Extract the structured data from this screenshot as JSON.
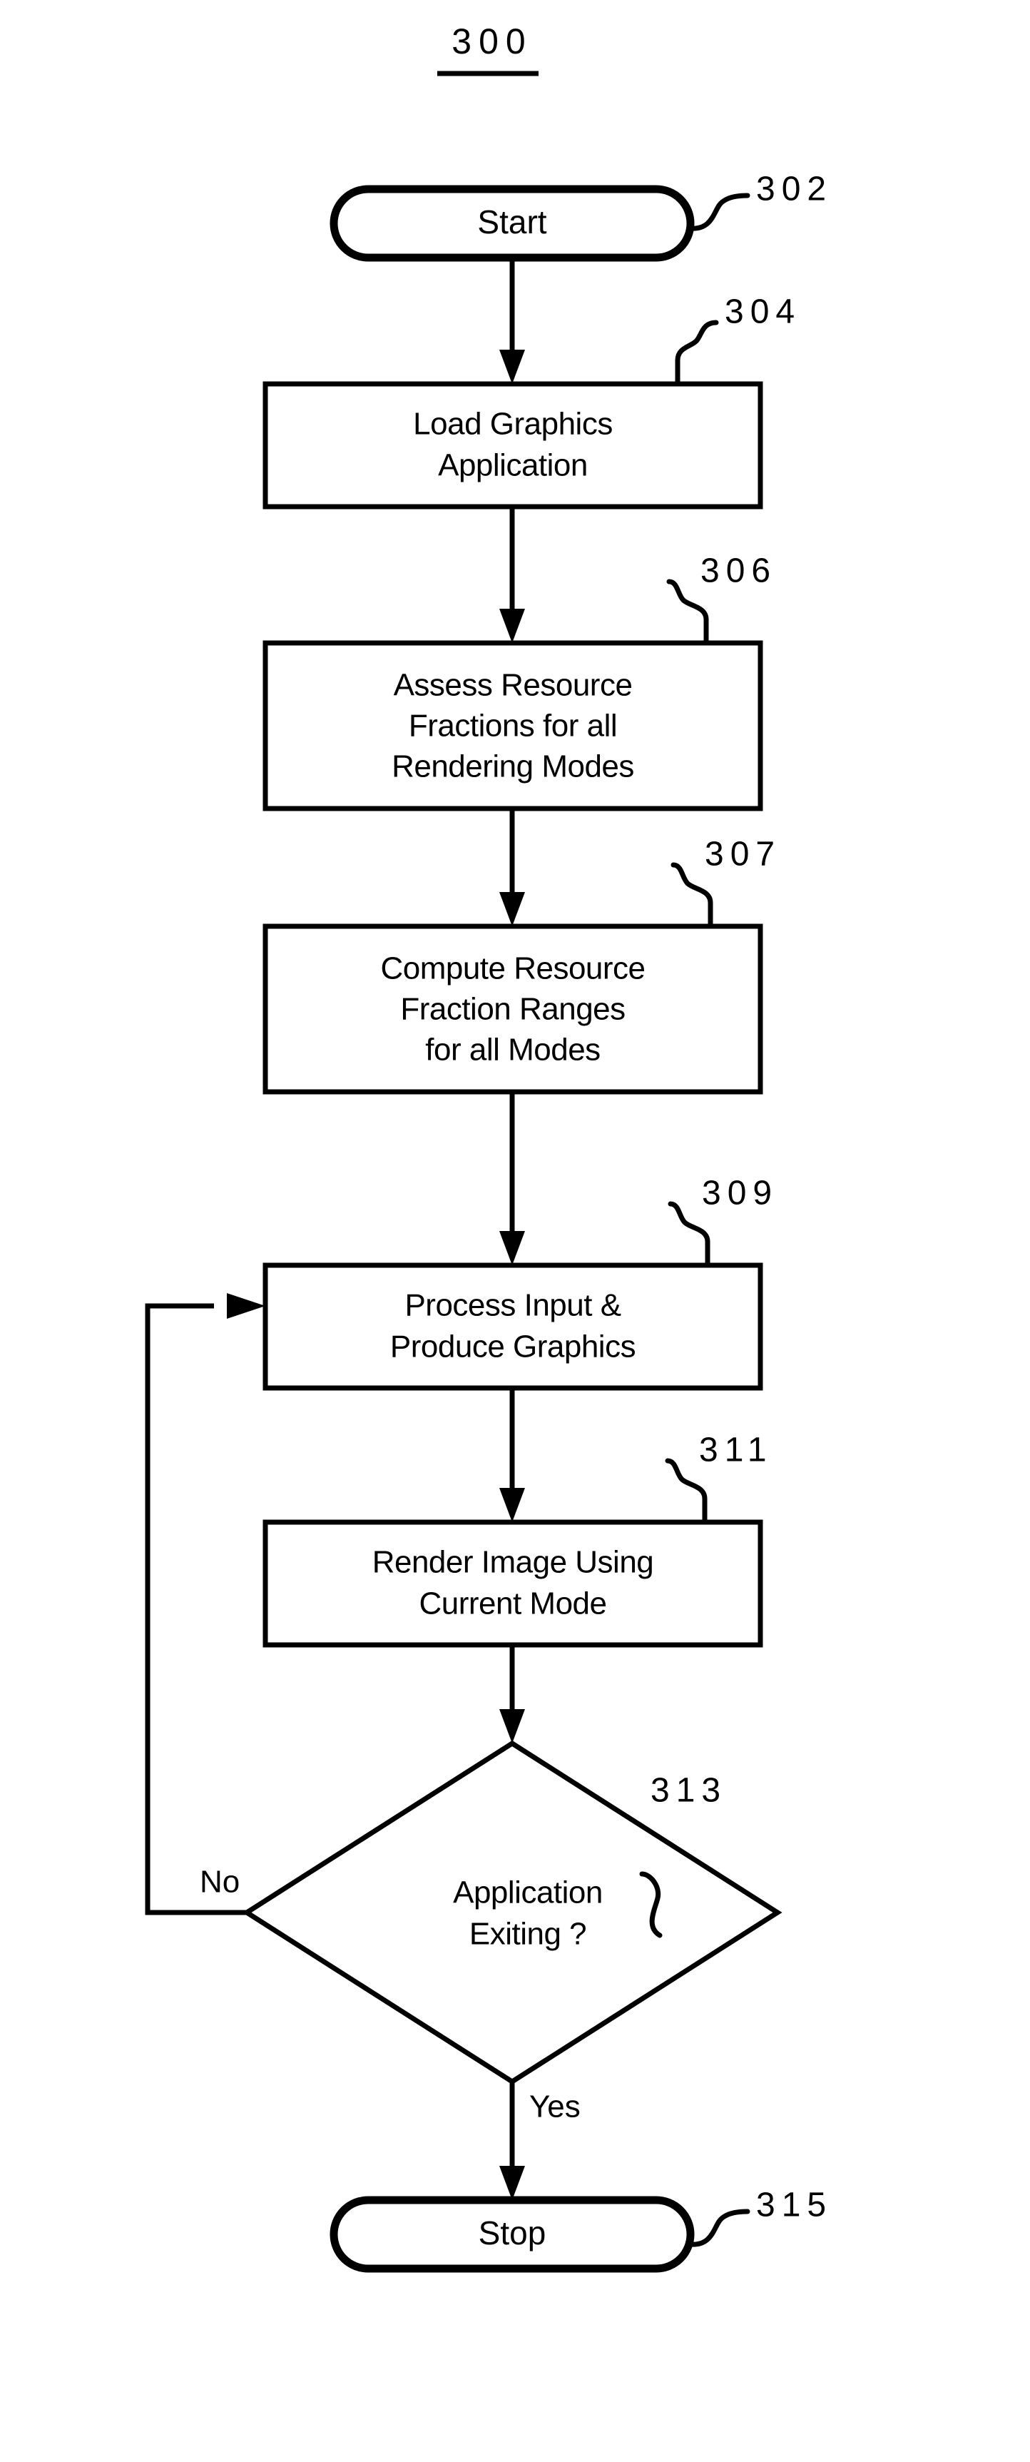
{
  "figure": {
    "title": "300",
    "title_underlined": true
  },
  "nodes": [
    {
      "id": "start",
      "ref": "302",
      "shape": "terminal",
      "lines": [
        "Start"
      ]
    },
    {
      "id": "load-graphics-application",
      "ref": "304",
      "shape": "process",
      "lines": [
        "Load Graphics",
        "Application"
      ]
    },
    {
      "id": "assess-resource-fractions",
      "ref": "306",
      "shape": "process",
      "lines": [
        "Assess Resource",
        "Fractions for all",
        "Rendering Modes"
      ]
    },
    {
      "id": "compute-resource-fraction-ranges",
      "ref": "307",
      "shape": "process",
      "lines": [
        "Compute Resource",
        "Fraction Ranges",
        "for all Modes"
      ]
    },
    {
      "id": "process-input-produce-graphics",
      "ref": "309",
      "shape": "process",
      "lines": [
        "Process Input &",
        "Produce Graphics"
      ]
    },
    {
      "id": "render-image-current-mode",
      "ref": "311",
      "shape": "process",
      "lines": [
        "Render Image Using",
        "Current Mode"
      ]
    },
    {
      "id": "application-exiting",
      "ref": "313",
      "shape": "decision",
      "lines": [
        "Application",
        "Exiting ?"
      ]
    },
    {
      "id": "stop",
      "ref": "315",
      "shape": "terminal",
      "lines": [
        "Stop"
      ]
    }
  ],
  "branch_labels": {
    "no": "No",
    "yes": "Yes"
  },
  "colors": {
    "ink": "#000000",
    "background": "#ffffff"
  },
  "chart_data": {
    "type": "table",
    "title": "300",
    "categories": [
      "302",
      "304",
      "306",
      "307",
      "309",
      "311",
      "313",
      "315"
    ],
    "values": [
      "Start",
      "Load Graphics Application",
      "Assess Resource Fractions for all Rendering Modes",
      "Compute Resource Fraction Ranges for all Modes",
      "Process Input & Produce Graphics",
      "Render Image Using Current Mode",
      "Application Exiting ?",
      "Stop"
    ],
    "edges": [
      "302 -> 304",
      "304 -> 306",
      "306 -> 307",
      "307 -> 309",
      "309 -> 311",
      "311 -> 313",
      "313 -No-> 309",
      "313 -Yes-> 315"
    ],
    "xlabel": "",
    "ylabel": ""
  }
}
